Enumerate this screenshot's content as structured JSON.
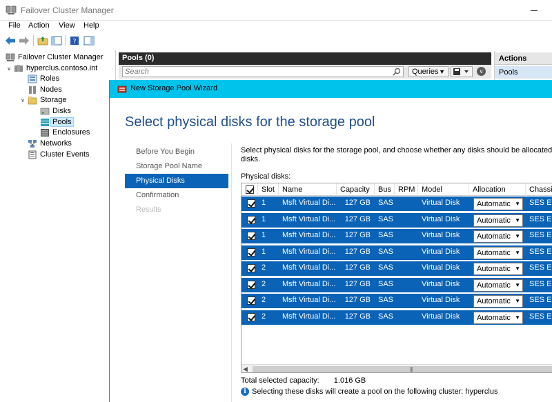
{
  "window": {
    "title": "Failover Cluster Manager"
  },
  "menu": [
    "File",
    "Action",
    "View",
    "Help"
  ],
  "tree": {
    "root": "Failover Cluster Manager",
    "cluster": "hyperclus.contoso.int",
    "items": [
      "Roles",
      "Nodes",
      "Storage",
      "Disks",
      "Pools",
      "Enclosures",
      "Networks",
      "Cluster Events"
    ]
  },
  "pools": {
    "header": "Pools (0)",
    "search_placeholder": "Search",
    "queries_label": "Queries"
  },
  "actions": {
    "header": "Actions",
    "item": "Pools"
  },
  "wizard": {
    "title": "New Storage Pool Wizard",
    "heading": "Select physical disks for the storage pool",
    "steps": [
      "Before You Begin",
      "Storage Pool Name",
      "Physical Disks",
      "Confirmation",
      "Results"
    ],
    "intro_line1": "Select physical disks for the storage pool, and choose whether any disks should be allocated as ho",
    "intro_line2": "disks.",
    "physical_disks_label": "Physical disks:",
    "columns": [
      "Slot",
      "Name",
      "Capacity",
      "Bus",
      "RPM",
      "Model",
      "Allocation",
      "Chassis"
    ],
    "rows": [
      {
        "slot": "1",
        "name": "Msft Virtual Di...",
        "capacity": "127 GB",
        "bus": "SAS",
        "rpm": "",
        "model": "Virtual Disk",
        "allocation": "Automatic",
        "chassis": "SES Enc"
      },
      {
        "slot": "1",
        "name": "Msft Virtual Di...",
        "capacity": "127 GB",
        "bus": "SAS",
        "rpm": "",
        "model": "Virtual Disk",
        "allocation": "Automatic",
        "chassis": "SES Enc"
      },
      {
        "slot": "1",
        "name": "Msft Virtual Di...",
        "capacity": "127 GB",
        "bus": "SAS",
        "rpm": "",
        "model": "Virtual Disk",
        "allocation": "Automatic",
        "chassis": "SES Enc"
      },
      {
        "slot": "1",
        "name": "Msft Virtual Di...",
        "capacity": "127 GB",
        "bus": "SAS",
        "rpm": "",
        "model": "Virtual Disk",
        "allocation": "Automatic",
        "chassis": "SES Enc"
      },
      {
        "slot": "2",
        "name": "Msft Virtual Di...",
        "capacity": "127 GB",
        "bus": "SAS",
        "rpm": "",
        "model": "Virtual Disk",
        "allocation": "Automatic",
        "chassis": "SES Enc"
      },
      {
        "slot": "2",
        "name": "Msft Virtual Di...",
        "capacity": "127 GB",
        "bus": "SAS",
        "rpm": "",
        "model": "Virtual Disk",
        "allocation": "Automatic",
        "chassis": "SES Enc"
      },
      {
        "slot": "2",
        "name": "Msft Virtual Di...",
        "capacity": "127 GB",
        "bus": "SAS",
        "rpm": "",
        "model": "Virtual Disk",
        "allocation": "Automatic",
        "chassis": "SES Enc"
      },
      {
        "slot": "2",
        "name": "Msft Virtual Di...",
        "capacity": "127 GB",
        "bus": "SAS",
        "rpm": "",
        "model": "Virtual Disk",
        "allocation": "Automatic",
        "chassis": "SES Enc"
      }
    ],
    "total_label": "Total selected capacity:",
    "total_value": "1.016 GB",
    "info_text": "Selecting these disks will create a pool on the following cluster: hyperclus"
  },
  "colors": {
    "selection": "#0a63b7",
    "wizard_titlebar": "#00c3ec",
    "heading": "#1f4e8c"
  }
}
